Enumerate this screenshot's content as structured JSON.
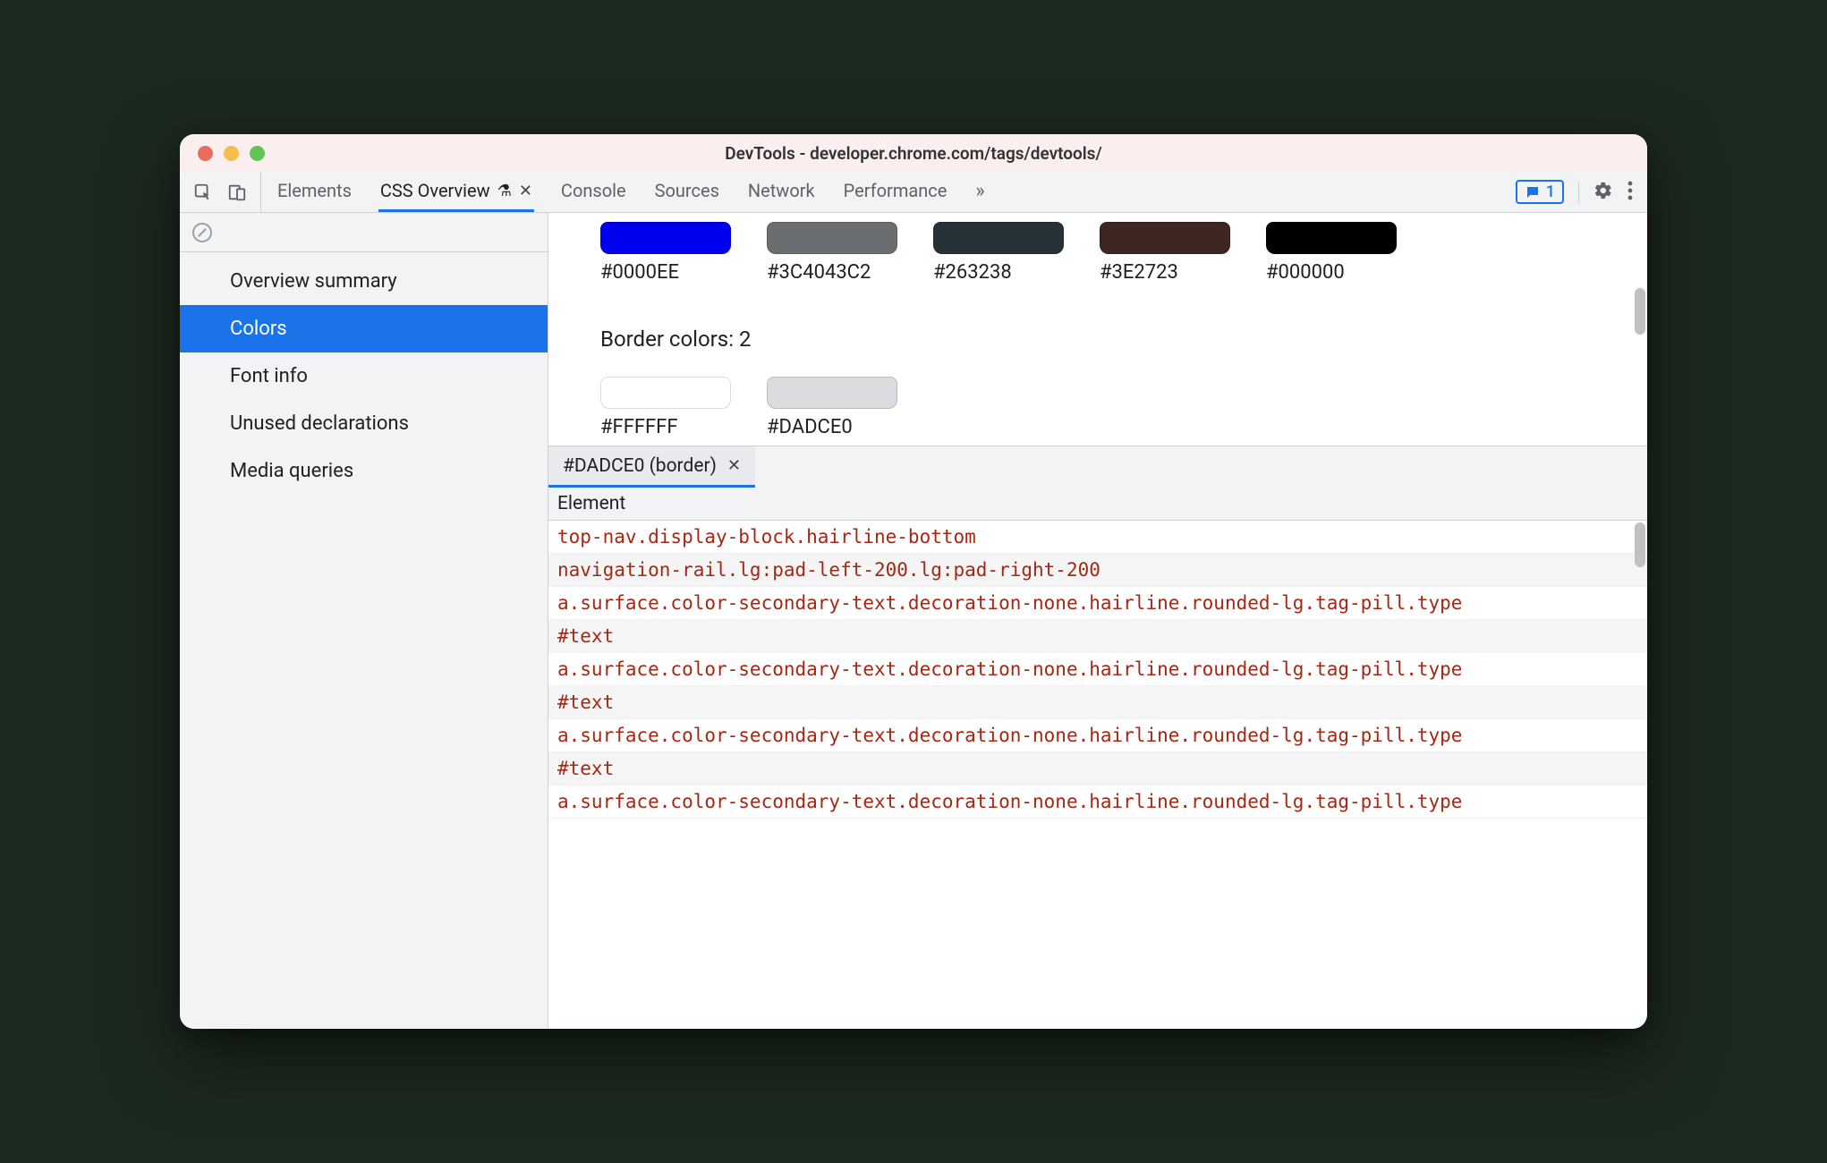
{
  "window_title": "DevTools - developer.chrome.com/tags/devtools/",
  "tabs": {
    "elements": "Elements",
    "css_overview": "CSS Overview",
    "console": "Console",
    "sources": "Sources",
    "network": "Network",
    "performance": "Performance"
  },
  "issues_count": "1",
  "sidebar": {
    "items": [
      "Overview summary",
      "Colors",
      "Font info",
      "Unused declarations",
      "Media queries"
    ]
  },
  "top_swatches": [
    {
      "color": "#0000EE",
      "label": "#0000EE"
    },
    {
      "color": "rgba(60,64,67,0.76)",
      "label": "#3C4043C2"
    },
    {
      "color": "#263238",
      "label": "#263238"
    },
    {
      "color": "#3E2723",
      "label": "#3E2723"
    },
    {
      "color": "#000000",
      "label": "#000000"
    }
  ],
  "border_section_title": "Border colors: 2",
  "border_swatches": [
    {
      "color": "#FFFFFF",
      "label": "#FFFFFF"
    },
    {
      "color": "#DADCE0",
      "label": "#DADCE0"
    }
  ],
  "detail": {
    "tab_label": "#DADCE0 (border)",
    "header": "Element",
    "rows": [
      "top-nav.display-block.hairline-bottom",
      "navigation-rail.lg:pad-left-200.lg:pad-right-200",
      "a.surface.color-secondary-text.decoration-none.hairline.rounded-lg.tag-pill.type",
      "#text",
      "a.surface.color-secondary-text.decoration-none.hairline.rounded-lg.tag-pill.type",
      "#text",
      "a.surface.color-secondary-text.decoration-none.hairline.rounded-lg.tag-pill.type",
      "#text",
      "a.surface.color-secondary-text.decoration-none.hairline.rounded-lg.tag-pill.type"
    ]
  }
}
